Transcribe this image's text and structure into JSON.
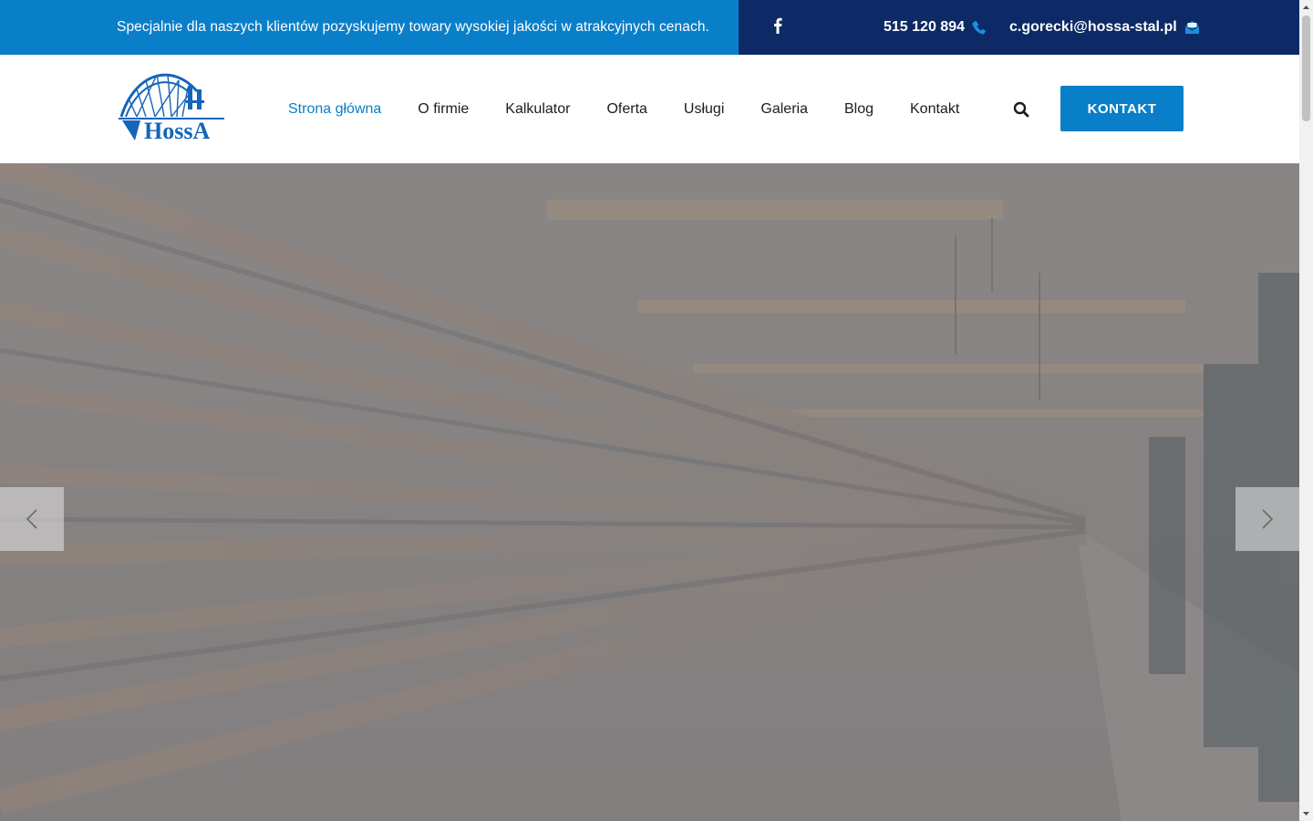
{
  "topbar": {
    "tagline": "Specjalnie dla naszych klientów pozyskujemy towary wysokiej jakości w atrakcyjnych cenach.",
    "phone": "515 120 894",
    "email": "c.gorecki@hossa-stal.pl"
  },
  "header": {
    "logo_text": "HossA",
    "nav": [
      {
        "label": "Strona główna"
      },
      {
        "label": "O firmie"
      },
      {
        "label": "Kalkulator"
      },
      {
        "label": "Oferta"
      },
      {
        "label": "Usługi"
      },
      {
        "label": "Galeria"
      },
      {
        "label": "Blog"
      },
      {
        "label": "Kontakt"
      }
    ],
    "cta_label": "KONTAKT"
  },
  "colors": {
    "primary": "#0a7fc9",
    "navy": "#0d2a66"
  },
  "icons": {
    "facebook": "facebook-icon",
    "phone": "phone-icon",
    "email": "envelope-icon",
    "search": "search-icon",
    "prev": "chevron-left-icon",
    "next": "chevron-right-icon"
  }
}
